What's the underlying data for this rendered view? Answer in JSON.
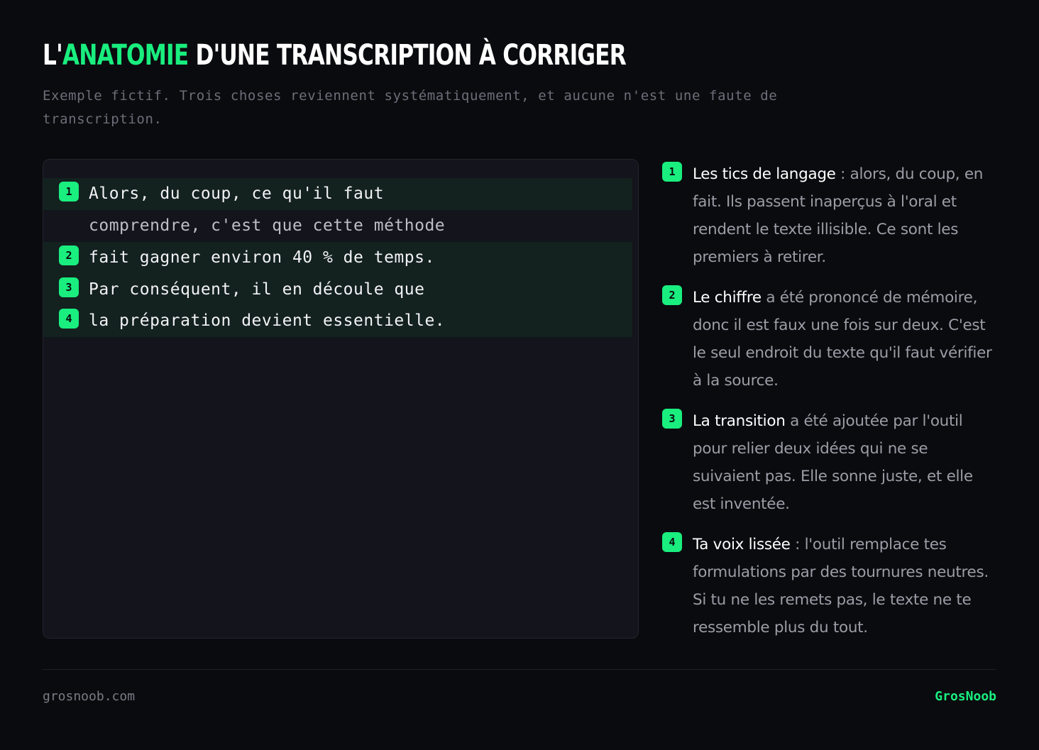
{
  "header": {
    "title_before": "L'",
    "title_accent": "ANATOMIE",
    "title_after": " D'UNE TRANSCRIPTION À CORRIGER",
    "subtitle": "Exemple fictif. Trois choses reviennent systématiquement, et aucune n'est une faute de transcription."
  },
  "transcript": {
    "lines": [
      {
        "badge": "1",
        "text": "Alors, du coup, ce qu'il faut"
      },
      {
        "badge": "",
        "text": "comprendre, c'est que cette méthode"
      },
      {
        "badge": "2",
        "text": "fait gagner environ 40 % de temps."
      },
      {
        "badge": "3",
        "text": "Par conséquent, il en découle que"
      },
      {
        "badge": "4",
        "text": "la préparation devient essentielle."
      }
    ]
  },
  "notes": [
    {
      "badge": "1",
      "strong": "Les tics de langage",
      "rest": " : alors, du coup, en fait. Ils passent inaperçus à l'oral et rendent le texte illisible. Ce sont les premiers à retirer."
    },
    {
      "badge": "2",
      "strong": "Le chiffre",
      "rest": " a été prononcé de mémoire, donc il est faux une fois sur deux. C'est le seul endroit du texte qu'il faut vérifier à la source."
    },
    {
      "badge": "3",
      "strong": "La transition",
      "rest": " a été ajoutée par l'outil pour relier deux idées qui ne se suivaient pas. Elle sonne juste, et elle est inventée."
    },
    {
      "badge": "4",
      "strong": "Ta voix lissée",
      "rest": " : l'outil remplace tes formulations par des tournures neutres. Si tu ne les remets pas, le texte ne te ressemble plus du tout."
    }
  ],
  "footer": {
    "site": "grosnoob.com",
    "brand": "GrosNoob"
  },
  "colors": {
    "background": "#0a0b0f",
    "accent": "#19ee7e",
    "panel": "#13141c",
    "highlight_row": "#13211f"
  }
}
